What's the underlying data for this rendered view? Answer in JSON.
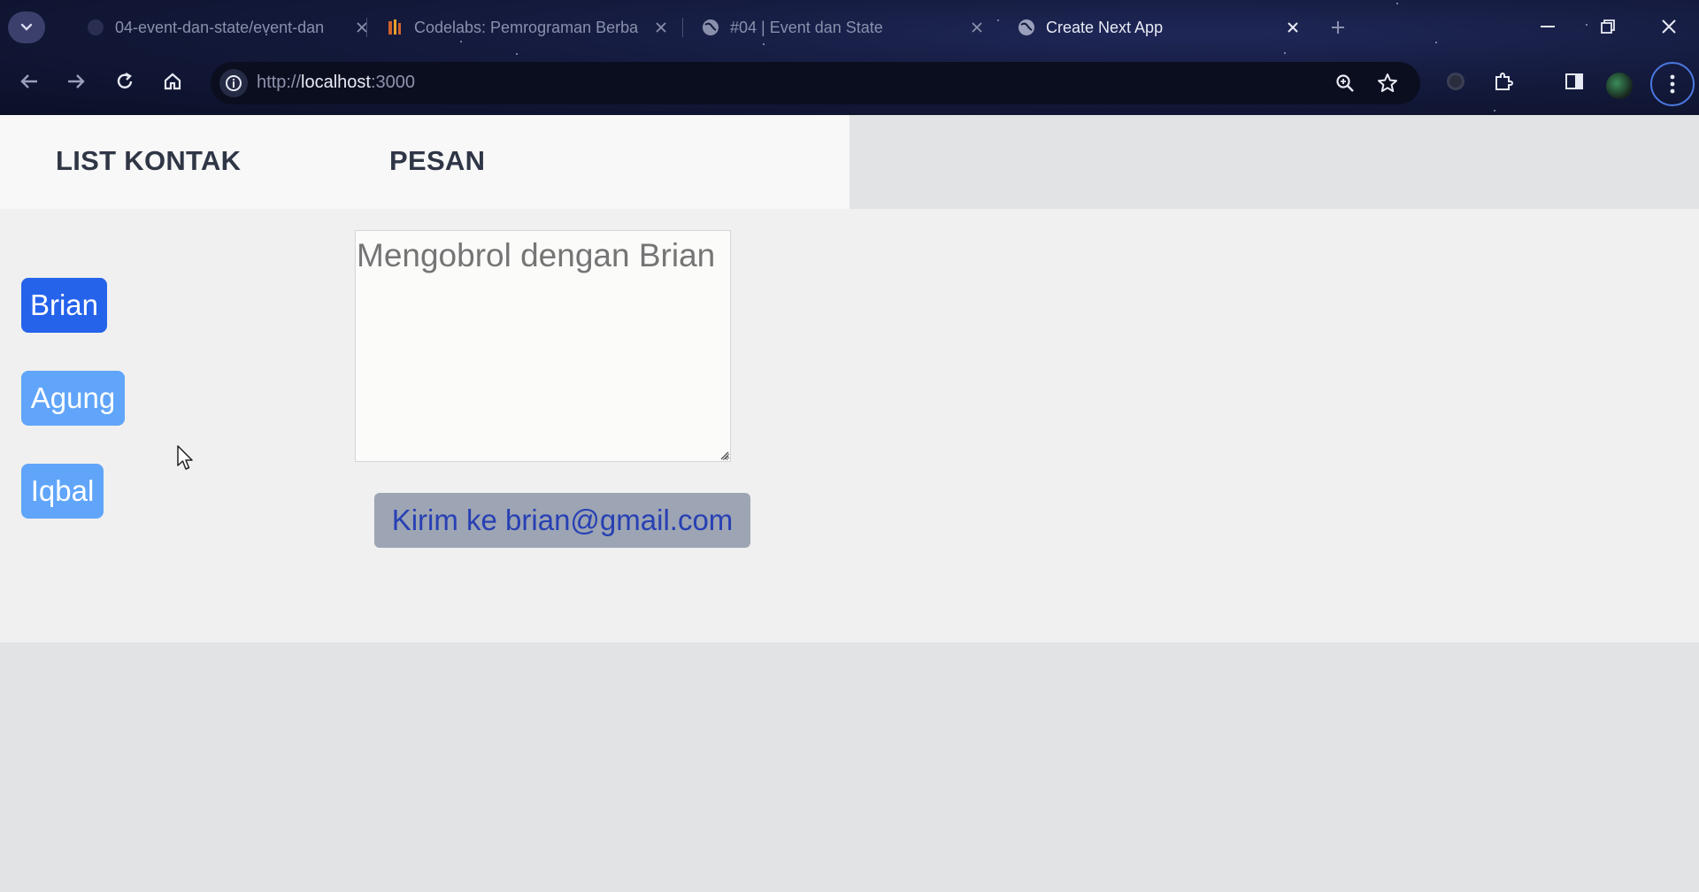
{
  "browser": {
    "tabs": [
      {
        "title": "04-event-dan-state/event-dan",
        "icon": "github-icon",
        "active": false
      },
      {
        "title": "Codelabs: Pemrograman Berba",
        "icon": "codelabs-icon",
        "active": false
      },
      {
        "title": "#04 | Event dan State",
        "icon": "globe-icon",
        "active": false
      },
      {
        "title": "Create Next App",
        "icon": "globe-icon",
        "active": true
      }
    ],
    "address_bar": {
      "scheme": "http://",
      "host": "localhost",
      "port": ":3000"
    }
  },
  "app": {
    "header": {
      "contacts_title": "LIST KONTAK",
      "message_title": "PESAN"
    },
    "contacts": [
      {
        "name": "Brian",
        "selected": true
      },
      {
        "name": "Agung",
        "selected": false
      },
      {
        "name": "Iqbal",
        "selected": false
      }
    ],
    "message": {
      "placeholder": "Mengobrol dengan Brian",
      "value": ""
    },
    "send_button": {
      "label": "Kirim ke brian@gmail.com"
    }
  },
  "colors": {
    "selected_contact": "#2563eb",
    "contact": "#60a5fa",
    "send_button_bg": "#9da4b3",
    "send_button_text": "#2740b4"
  }
}
